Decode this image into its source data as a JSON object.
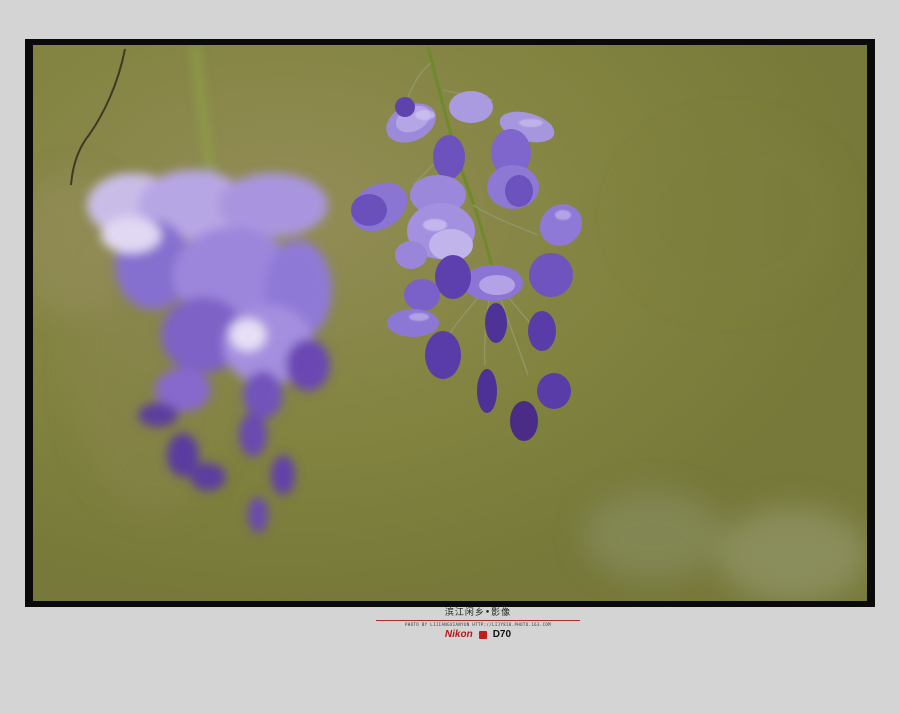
{
  "photo": {
    "subject": "wisteria-flowers",
    "colors": {
      "background": "#84833f",
      "petal": "#7f62c8",
      "petal_light": "#b7a7e6",
      "bud": "#4a2b86",
      "stem": "#6f8a2c"
    }
  },
  "caption": {
    "title": "滨江闲乡•影像",
    "credit": "PHOTO BY LIJIANGXIANYUN HTTP://LIJY818.PHOTO.163.COM",
    "brand": "Nikon",
    "model": "D70"
  }
}
